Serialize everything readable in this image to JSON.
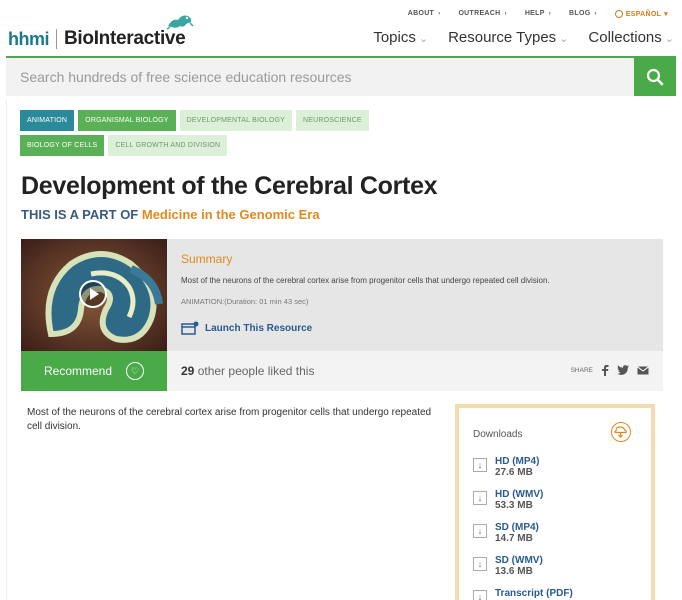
{
  "util_nav": [
    {
      "label": "ABOUT"
    },
    {
      "label": "OUTREACH"
    },
    {
      "label": "HELP"
    },
    {
      "label": "BLOG"
    }
  ],
  "language": "ESPAÑOL",
  "logo": {
    "org": "hhmi",
    "site": "BioInteractive"
  },
  "main_nav": [
    {
      "label": "Topics"
    },
    {
      "label": "Resource Types"
    },
    {
      "label": "Collections"
    }
  ],
  "search": {
    "placeholder": "Search hundreds of free science education resources"
  },
  "tags": [
    {
      "label": "ANIMATION",
      "style": "teal"
    },
    {
      "label": "ORGANISMAL BIOLOGY",
      "style": "green"
    },
    {
      "label": "DEVELOPMENTAL BIOLOGY",
      "style": "light"
    },
    {
      "label": "NEUROSCIENCE",
      "style": "light"
    },
    {
      "label": "BIOLOGY OF CELLS",
      "style": "green"
    },
    {
      "label": "CELL GROWTH AND DIVISION",
      "style": "light"
    }
  ],
  "page": {
    "title": "Development of the Cerebral Cortex",
    "part_prefix": "THIS IS A PART OF",
    "part_link": "Medicine in the Genomic Era"
  },
  "summary": {
    "heading": "Summary",
    "text": "Most of the neurons of the cerebral cortex arise from progenitor cells that undergo repeated cell division.",
    "meta": "ANIMATION:(Duration: 01 min 43 sec)",
    "launch": "Launch This Resource"
  },
  "recommend": {
    "label": "Recommend"
  },
  "likes": {
    "count": "29",
    "text": "other people liked this"
  },
  "share": {
    "label": "SHARE"
  },
  "description": "Most of the neurons of the cerebral cortex arise from progenitor cells that undergo repeated cell division.",
  "downloads": {
    "heading": "Downloads",
    "items": [
      {
        "label": "HD (MP4)",
        "size": "27.6 MB"
      },
      {
        "label": "HD (WMV)",
        "size": "53.3 MB"
      },
      {
        "label": "SD (MP4)",
        "size": "14.7 MB"
      },
      {
        "label": "SD (WMV)",
        "size": "13.6 MB"
      },
      {
        "label": "Transcript (PDF)",
        "size": ""
      }
    ]
  },
  "colors": {
    "brand_green": "#4aaa48",
    "accent_orange": "#e08a1e",
    "teal": "#2a8a9a",
    "link_blue": "#2a5a90"
  }
}
